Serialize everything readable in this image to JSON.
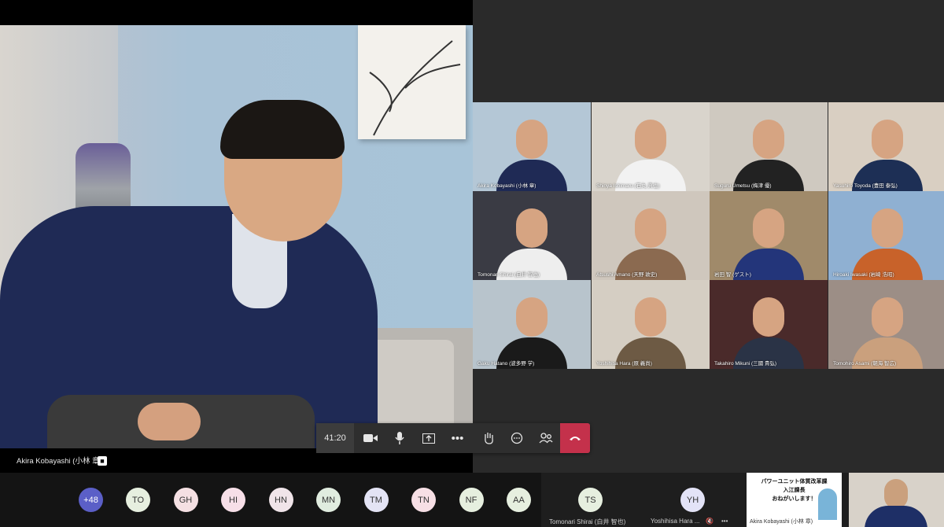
{
  "call": {
    "timer": "41:20"
  },
  "speaker": {
    "name": "Akira Kobayashi (小林 章)"
  },
  "grid": [
    {
      "name": "Akira Kobayashi (小林 章)"
    },
    {
      "name": "Shinya Ishimaru (石丸 真也)"
    },
    {
      "name": "Suguru Umetsu (梅津 優)"
    },
    {
      "name": "Yasuhiro Toyoda (豊田 泰弘)"
    },
    {
      "name": "Tomonari Shirai (白井 智也)"
    },
    {
      "name": "Atsushi Amano (天野 敦史)"
    },
    {
      "name": "岩田 智 (ゲスト)"
    },
    {
      "name": "Hiroaki Iwasaki (岩崎 浩昭)"
    },
    {
      "name": "Gaku Hatano (波多野 学)"
    },
    {
      "name": "Yoshihisa Hara (原 義尚)"
    },
    {
      "name": "Takahiro Mikuni (三國 貴弘)"
    },
    {
      "name": "Tomohiro Asami (朝海 智広)"
    }
  ],
  "roster": {
    "overflow": "+48",
    "initials": [
      "TO",
      "GH",
      "HI",
      "HN",
      "MN",
      "TM",
      "TN",
      "NF",
      "AA"
    ]
  },
  "slots": [
    {
      "initials": "TS",
      "name": "Tomonari Shirai (白井 智也)"
    },
    {
      "initials": "YH",
      "name": "Yoshihisa Hara ..."
    }
  ],
  "share_thumb": {
    "line1": "パワーユニット体質改革課",
    "line2": "入江課長",
    "line3": "おねがいします！",
    "name": "Akira Kobayashi (小林 章)"
  },
  "colors": {
    "hangup": "#c4314b",
    "overflow_avatar": "#5b5fc7"
  }
}
